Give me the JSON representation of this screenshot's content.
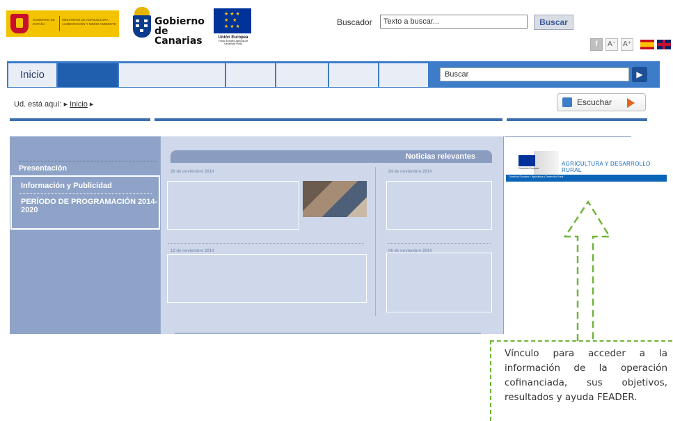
{
  "header": {
    "gobierno_espana": {
      "line1": "GOBIERNO DE ESPAÑA",
      "line2": "MINISTERIO DE AGRICULTURA, ALIMENTACIÓN Y MEDIO AMBIENTE"
    },
    "gobierno_canarias": {
      "name": "Gobierno de Canarias"
    },
    "union_europea": {
      "title": "Unión Europea",
      "subtitle": "Fondo Europeo Agrícola de Desarrollo Rural"
    },
    "search": {
      "label": "Buscador",
      "placeholder": "Texto a buscar...",
      "button": "Buscar"
    },
    "tools": {
      "facebook": "f",
      "font_smaller": "A⁻",
      "font_larger": "A⁺"
    }
  },
  "nav": {
    "home": "Inicio",
    "search_placeholder": "Buscar",
    "go": "▶"
  },
  "breadcrumb": {
    "prefix": "Ud. está aquí:",
    "item": "Inicio"
  },
  "listen": {
    "label": "Escuchar"
  },
  "sidebar": {
    "items": [
      {
        "label": "Presentación"
      },
      {
        "label": "Información y Publicidad"
      },
      {
        "label": "PERÍODO DE PROGRAMACIÓN 2014-2020"
      }
    ]
  },
  "news": {
    "header": "Noticias relevantes",
    "dates": [
      "26 de noviembre 2014",
      "24 de noviembre 2014",
      "12 de noviembre 2014",
      "06 de noviembre 2014"
    ]
  },
  "right_banner": {
    "title": "AGRICULTURA Y DESARROLLO RURAL",
    "eu_label": "Comisión Europea",
    "bottom": "Comisión Europea > Agricultura y Desarrollo Rural"
  },
  "annotation": {
    "text": "Vínculo para acceder a la información de la operación cofinanciada, sus objetivos, resultados y ayuda FEADER."
  },
  "colors": {
    "nav_blue": "#3d7cc9",
    "sidebar": "#8ea3c7",
    "content_bg": "#ced8ea",
    "annotation_green": "#70b53a"
  }
}
